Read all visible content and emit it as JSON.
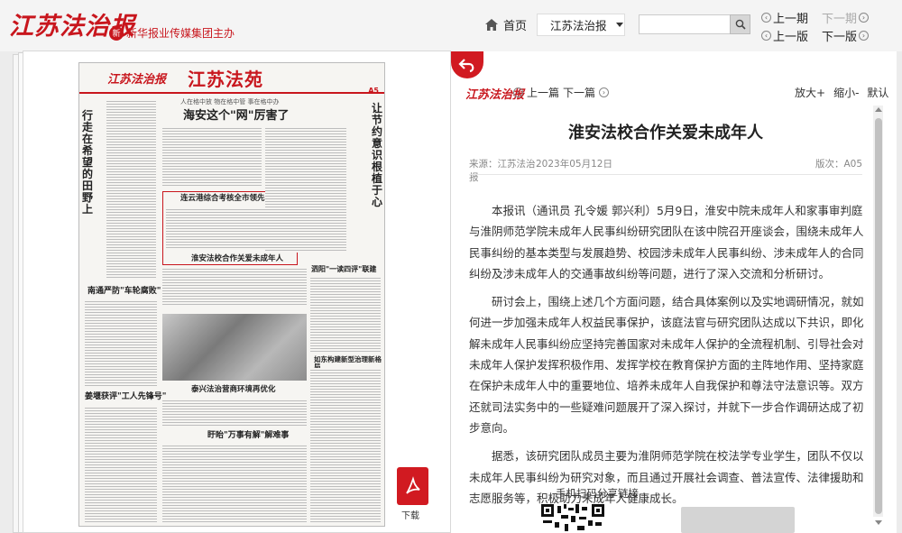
{
  "site": {
    "logo_text": "江苏法治报",
    "host_text": "新华报业传媒集团主办",
    "host_mark": "新"
  },
  "nav": {
    "home_label": "首页",
    "edition_selected": "江苏法治报",
    "search_placeholder": "",
    "prev_issue": "上一期",
    "next_issue": "下一期",
    "prev_page": "上一版",
    "next_page": "下一版"
  },
  "newspaper": {
    "logo": "江苏法治报",
    "page_title": "江苏法苑",
    "page_id": "A5",
    "headlines": {
      "lead": "海安这个\"网\"厉害了",
      "left_vertical": "行走在希望的田野上",
      "right_vertical": "让节约意识根植于心",
      "lianyungang": "连云港综合考核全市领先",
      "huaian": "淮安法校合作关爱未成年人",
      "nantong": "南通严防\"车轮腐败\"",
      "siyang": "泗阳\"一读四评\"联建",
      "taixing": "泰兴法治营商环境再优化",
      "jiangyan": "姜堰获评\"工人先锋号\"",
      "rugao": "如东构建新型治理新格局",
      "tiaojie": "盱眙\"万事有解\"解难事",
      "kicker": "人在格中放 物在格中管 事在格中办"
    }
  },
  "pdf": {
    "label": "下载"
  },
  "article": {
    "logo": "江苏法治报",
    "prev_article": "上一篇",
    "next_article": "下一篇",
    "zoom_in": "放大+",
    "zoom_out": "缩小-",
    "zoom_default": "默认",
    "title": "淮安法校合作关爱未成年人",
    "source": "来源：江苏法治报",
    "date": "2023年05月12日",
    "edition": "版次：A05",
    "paragraphs": [
      "本报讯（通讯员 孔令媛 郭兴利）5月9日，淮安中院未成年人和家事审判庭与淮阴师范学院未成年人民事纠纷研究团队在该中院召开座谈会，围绕未成年人民事纠纷的基本类型与发展趋势、校园涉未成年人民事纠纷、涉未成年人的合同纠纷及涉未成年人的交通事故纠纷等问题，进行了深入交流和分析研讨。",
      "研讨会上，围绕上述几个方面问题，结合具体案例以及实地调研情况，就如何进一步加强未成年人权益民事保护，该庭法官与研究团队达成以下共识，即化解未成年人民事纠纷应坚持完善国家对未成年人保护的全流程机制、引导社会对未成年人保护发挥积极作用、发挥学校在教育保护方面的主阵地作用、坚持家庭在保护未成年人中的重要地位、培养未成年人自我保护和尊法守法意识等。双方还就司法实务中的一些疑难问题展开了深入探讨，并就下一步合作调研达成了初步意向。",
      "据悉，该研究团队成员主要为淮阴师范学院在校法学专业学生，团队不仅以未成年人民事纠纷为研究对象，而且通过开展社会调查、普法宣传、法律援助和志愿服务等，积极助力未成年人健康成长。"
    ],
    "qr_label": "手机扫码分享链接"
  },
  "colors": {
    "brand_red": "#c8161d"
  }
}
